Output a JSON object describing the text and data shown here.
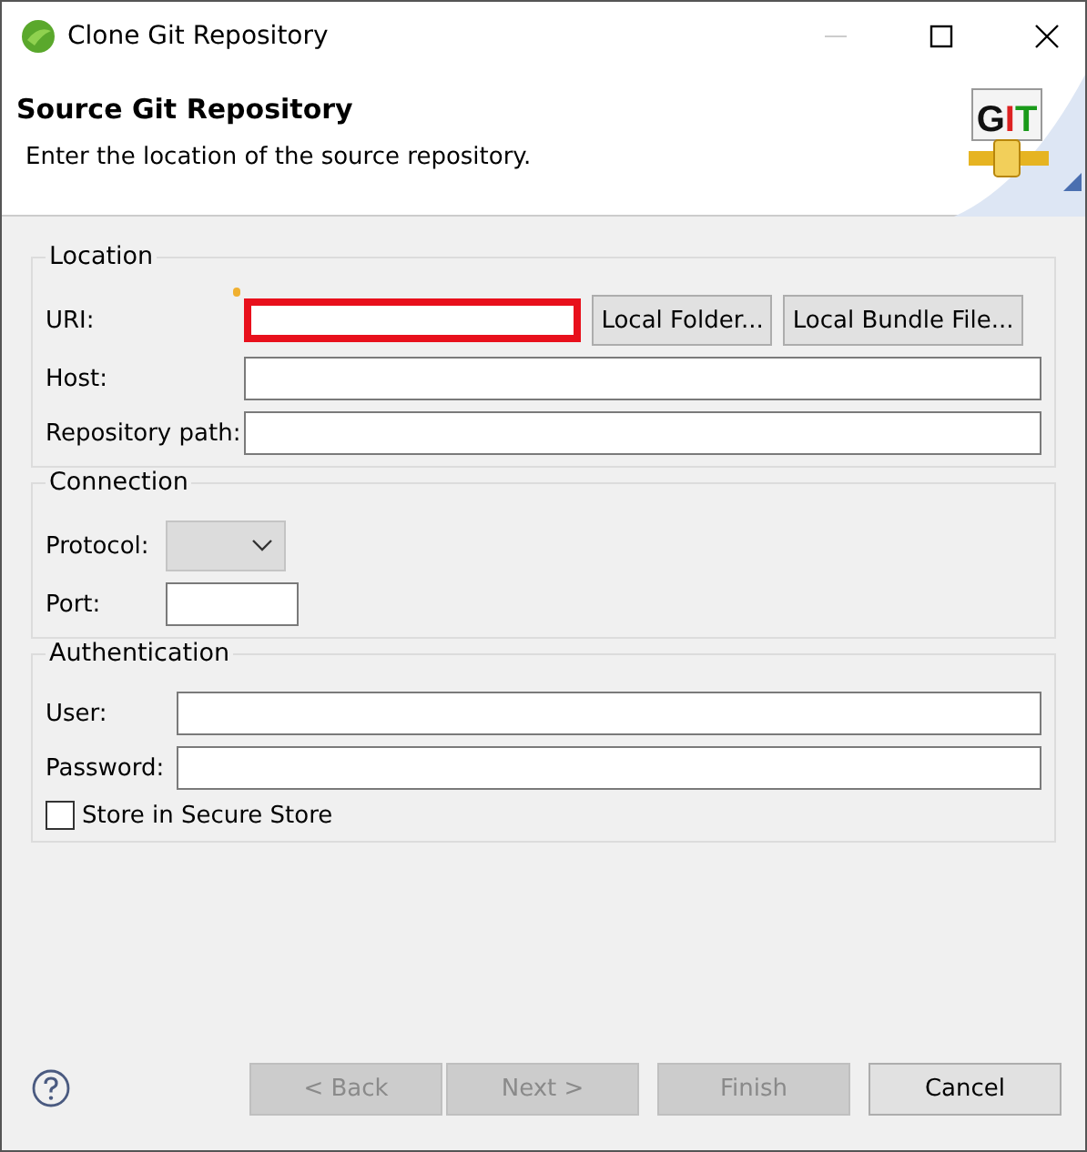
{
  "window": {
    "title": "Clone Git Repository"
  },
  "header": {
    "logo_text": "GIT",
    "title": "Source Git Repository",
    "description": "Enter the location of the source repository."
  },
  "groups": [
    {
      "title": "Location",
      "rows": [
        {
          "kind": "uri",
          "label": "URI:",
          "highlighted": true,
          "buttons": [
            {
              "label": "Local Folder..."
            },
            {
              "label": "Local Bundle File..."
            }
          ]
        },
        {
          "kind": "text",
          "label": "Host:"
        },
        {
          "kind": "text",
          "label": "Repository path:"
        }
      ]
    },
    {
      "title": "Connection",
      "rows": [
        {
          "kind": "combo",
          "label": "Protocol:",
          "disabled": true
        },
        {
          "kind": "short",
          "label": "Port:"
        }
      ]
    },
    {
      "title": "Authentication",
      "rows": [
        {
          "kind": "text",
          "label": "User:"
        },
        {
          "kind": "text",
          "label": "Password:"
        },
        {
          "kind": "check",
          "label": "Store in Secure Store",
          "checked": false
        }
      ]
    }
  ],
  "buttons": [
    {
      "label": "< Back",
      "disabled": true
    },
    {
      "label": "Next >",
      "disabled": true
    },
    {
      "label": "Finish",
      "disabled": true
    },
    {
      "label": "Cancel",
      "disabled": false
    }
  ]
}
